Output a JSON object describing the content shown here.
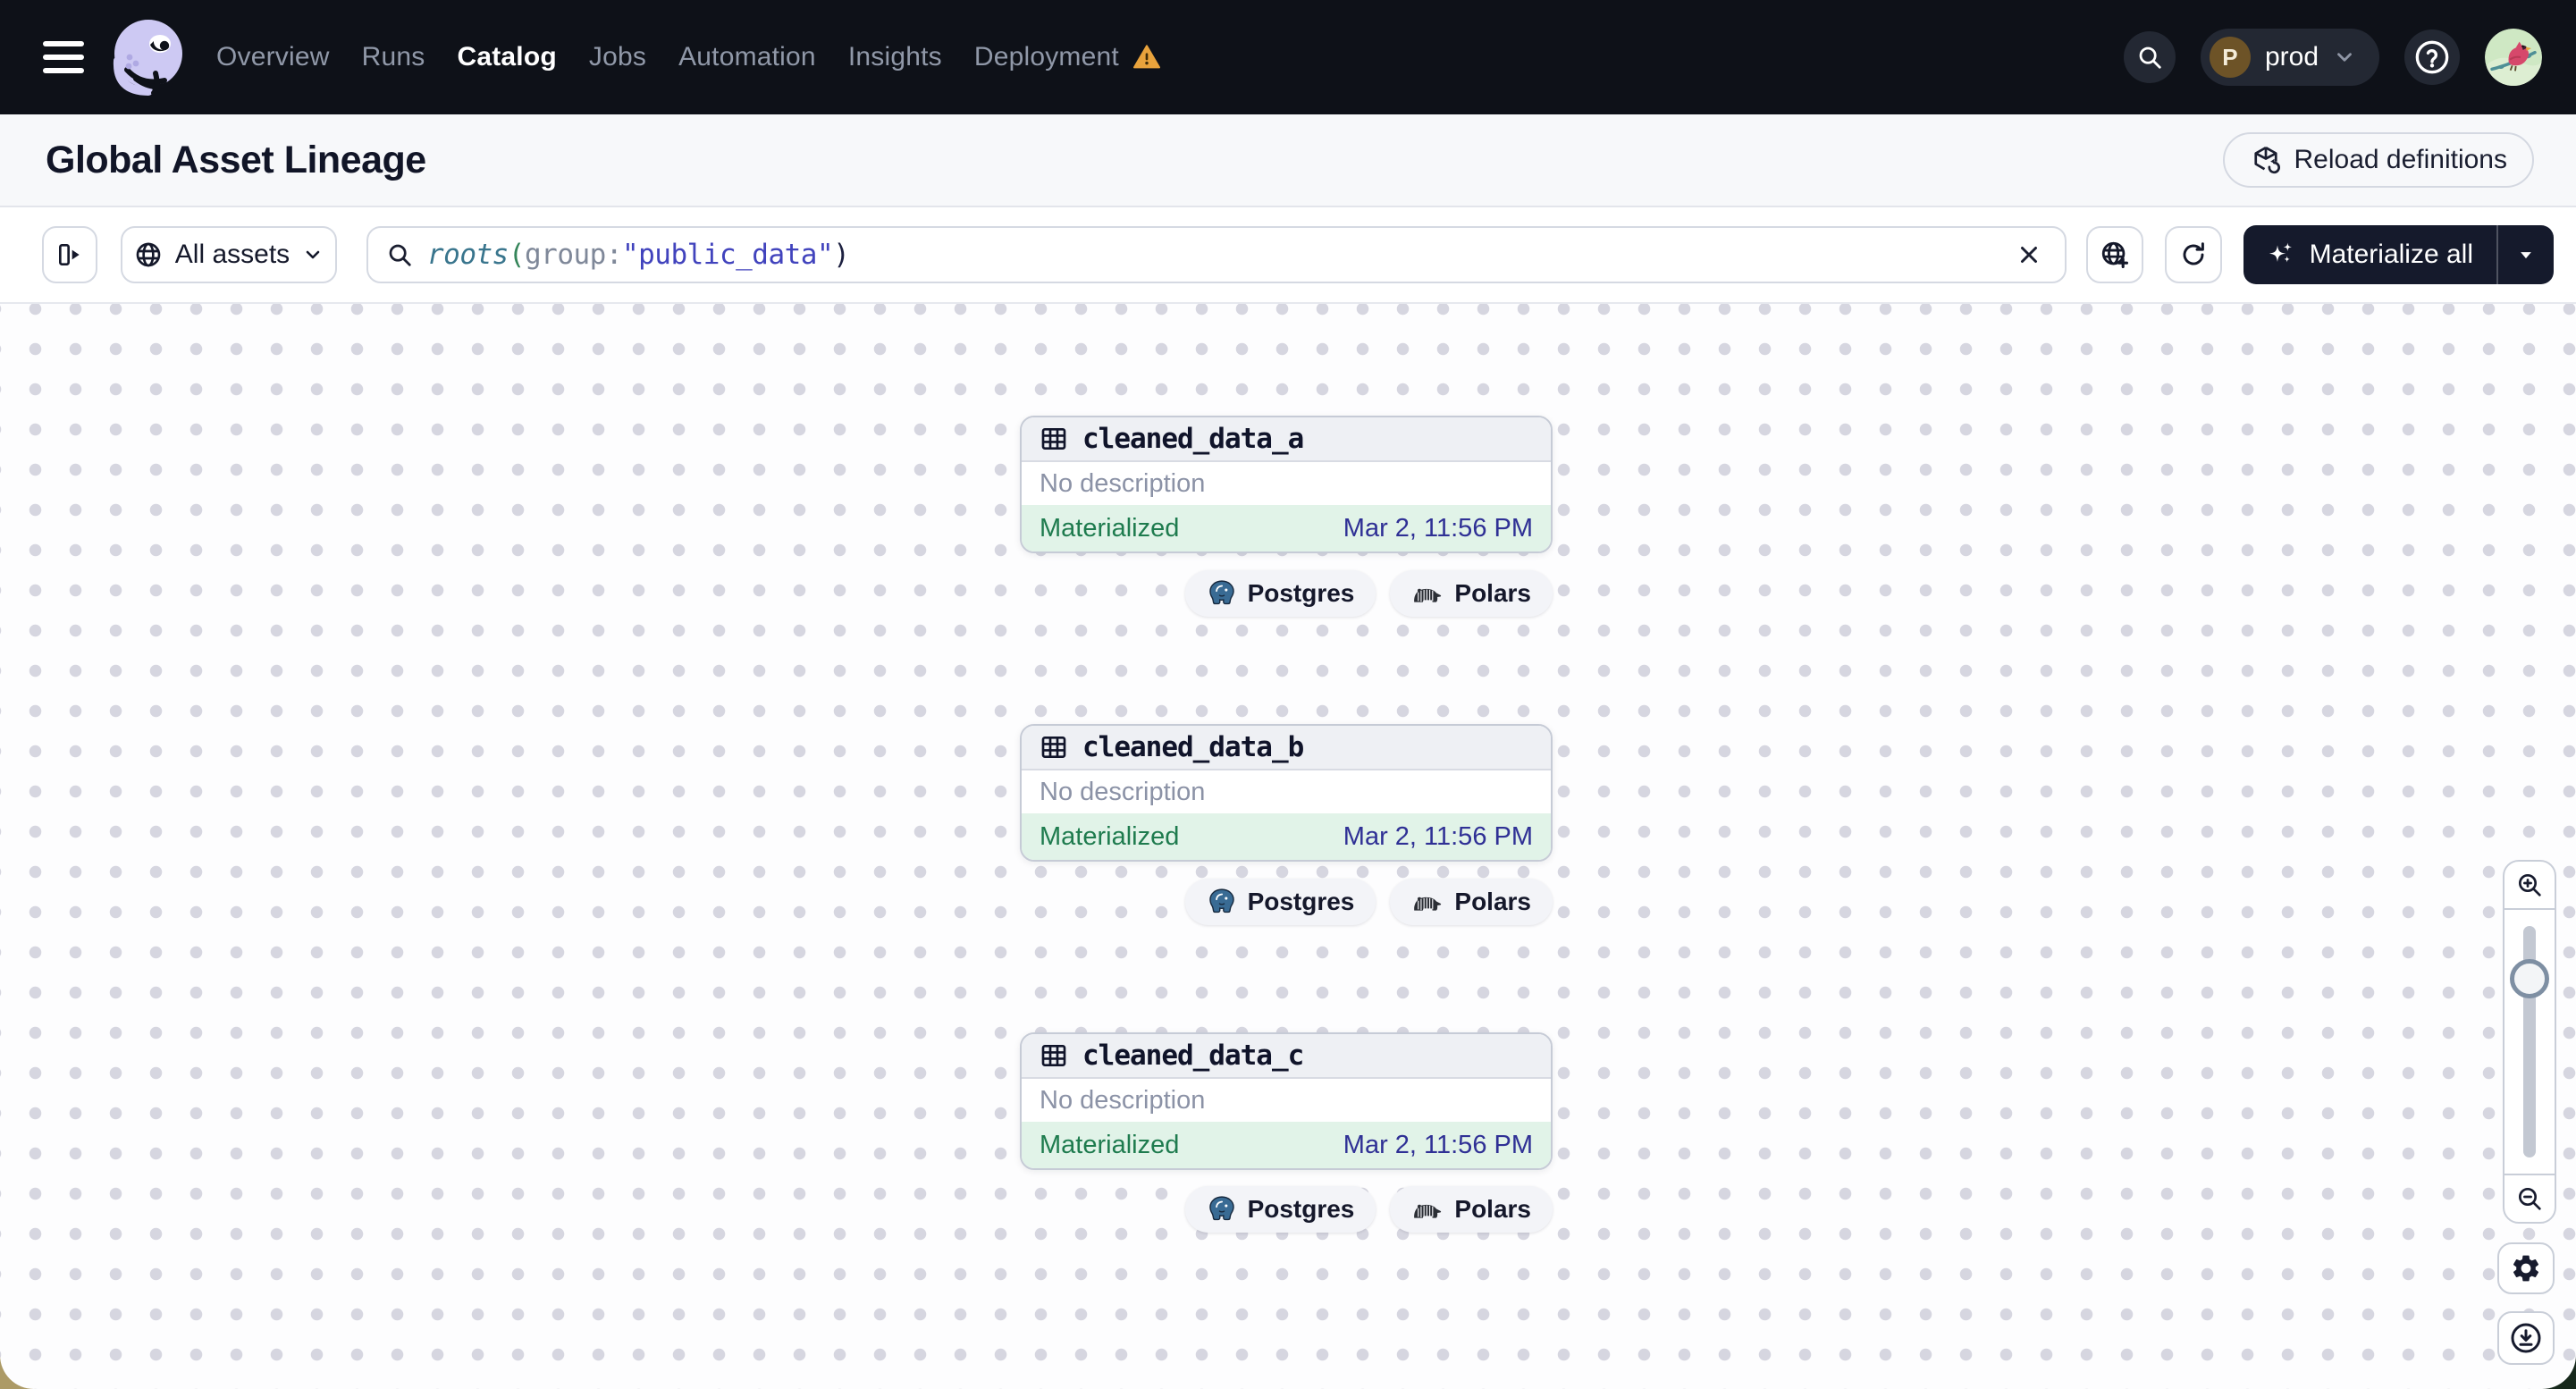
{
  "nav": {
    "items": [
      {
        "label": "Overview"
      },
      {
        "label": "Runs"
      },
      {
        "label": "Catalog"
      },
      {
        "label": "Jobs"
      },
      {
        "label": "Automation"
      },
      {
        "label": "Insights"
      },
      {
        "label": "Deployment"
      }
    ],
    "active_item": "Catalog",
    "deployment_has_warning": true,
    "environment": {
      "badge_letter": "P",
      "name": "prod"
    }
  },
  "header": {
    "title": "Global Asset Lineage",
    "reload_button_label": "Reload definitions"
  },
  "toolbar": {
    "scope_button_label": "All assets",
    "search": {
      "query_segments": [
        {
          "text": "roots",
          "color": "#39758D",
          "italic": true
        },
        {
          "text": "(",
          "color": "#35855A"
        },
        {
          "text": "group:",
          "color": "#7F8899"
        },
        {
          "text": "\"public_data\"",
          "color": "#4143BD"
        },
        {
          "text": ")",
          "color": "#1C2040"
        }
      ]
    },
    "materialize_button_label": "Materialize all"
  },
  "graph": {
    "nodes": [
      {
        "name": "cleaned_data_a",
        "description": "No description",
        "status": "Materialized",
        "status_time": "Mar 2, 11:56 PM",
        "kinds": [
          "Postgres",
          "Polars"
        ]
      },
      {
        "name": "cleaned_data_b",
        "description": "No description",
        "status": "Materialized",
        "status_time": "Mar 2, 11:56 PM",
        "kinds": [
          "Postgres",
          "Polars"
        ]
      },
      {
        "name": "cleaned_data_c",
        "description": "No description",
        "status": "Materialized",
        "status_time": "Mar 2, 11:56 PM",
        "kinds": [
          "Postgres",
          "Polars"
        ]
      }
    ]
  },
  "colors": {
    "navbar_bg": "#0E1118",
    "nav_item": "#9098A8",
    "nav_item_active": "#FFFFFF",
    "warning": "#E9A33C",
    "dark_button_bg": "#151A2C",
    "status_materialized_text": "#1E7B4E",
    "status_materialized_bg": "#E1F3E8",
    "timestamp_text": "#2F3095",
    "node_header_bg": "#EEF0F4",
    "canvas_dot": "#D6D6E0",
    "corner_left": "#AC9A66",
    "corner_right": "#17291C"
  },
  "icons": {
    "brand": "dagster-octopus",
    "nav_right": [
      "search",
      "help",
      "avatar-bird"
    ],
    "toolbar": [
      "panel-toggle",
      "globe",
      "search",
      "clear-x",
      "globe-plus",
      "refresh",
      "sparkles",
      "caret-down"
    ],
    "node": [
      "table-grid"
    ],
    "kinds": [
      "postgres-elephant",
      "polars-bear"
    ],
    "view_controls": [
      "zoom-in",
      "zoom-out",
      "gear",
      "download"
    ]
  }
}
